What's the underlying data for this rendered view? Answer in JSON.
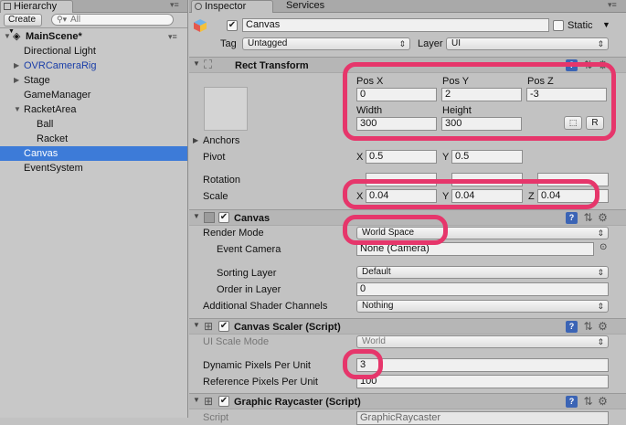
{
  "hierarchy": {
    "tab_label": "Hierarchy",
    "create_label": "Create",
    "search_placeholder": "All",
    "scene_name": "MainScene*",
    "items": [
      {
        "label": "Directional Light"
      },
      {
        "label": "OVRCameraRig"
      },
      {
        "label": "Stage"
      },
      {
        "label": "GameManager"
      },
      {
        "label": "RacketArea"
      },
      {
        "label": "Ball"
      },
      {
        "label": "Racket"
      },
      {
        "label": "Canvas"
      },
      {
        "label": "EventSystem"
      }
    ]
  },
  "inspector": {
    "tabs": [
      "Inspector",
      "Services"
    ],
    "object_name": "Canvas",
    "static_label": "Static",
    "tag_label": "Tag",
    "tag_value": "Untagged",
    "layer_label": "Layer",
    "layer_value": "UI",
    "rect_transform": {
      "title": "Rect Transform",
      "pos_x_label": "Pos X",
      "pos_x": "0",
      "pos_y_label": "Pos Y",
      "pos_y": "2",
      "pos_z_label": "Pos Z",
      "pos_z": "-3",
      "width_label": "Width",
      "width": "300",
      "height_label": "Height",
      "height": "300",
      "raw_button": "R",
      "anchors_label": "Anchors",
      "pivot_label": "Pivot",
      "pivot_x_label": "X",
      "pivot_x": "0.5",
      "pivot_y_label": "Y",
      "pivot_y": "0.5",
      "rotation_label": "Rotation",
      "scale_label": "Scale",
      "scale_x_label": "X",
      "scale_x": "0.04",
      "scale_y_label": "Y",
      "scale_y": "0.04",
      "scale_z_label": "Z",
      "scale_z": "0.04"
    },
    "canvas": {
      "title": "Canvas",
      "render_mode_label": "Render Mode",
      "render_mode": "World Space",
      "event_camera_label": "Event Camera",
      "event_camera": "None (Camera)",
      "sorting_layer_label": "Sorting Layer",
      "sorting_layer": "Default",
      "order_label": "Order in Layer",
      "order": "0",
      "shader_label": "Additional Shader Channels",
      "shader": "Nothing"
    },
    "canvas_scaler": {
      "title": "Canvas Scaler (Script)",
      "scale_mode_label": "UI Scale Mode",
      "scale_mode": "World",
      "dynamic_label": "Dynamic Pixels Per Unit",
      "dynamic": "3",
      "reference_label": "Reference Pixels Per Unit",
      "reference": "100"
    },
    "graphic_raycaster": {
      "title": "Graphic Raycaster (Script)",
      "script_label": "Script",
      "script": "GraphicRaycaster"
    },
    "help_icon_text": "?"
  },
  "highlight_color": "#e6366b",
  "selection_color": "#3d7bd8"
}
